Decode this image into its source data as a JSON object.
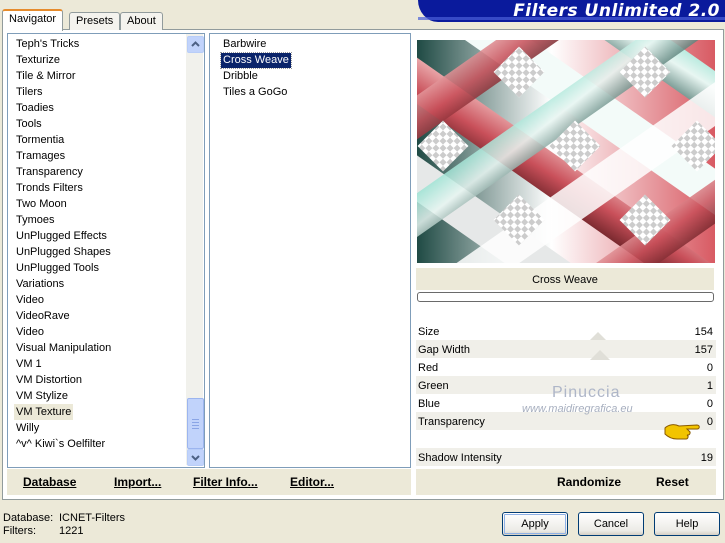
{
  "banner": {
    "title": "Filters Unlimited 2.0"
  },
  "tabs": [
    {
      "label": "Navigator",
      "active": true
    },
    {
      "label": "Presets",
      "active": false
    },
    {
      "label": "About",
      "active": false
    }
  ],
  "categories": [
    "Teph's Tricks",
    "Texturize",
    "Tile & Mirror",
    "Tilers",
    "Toadies",
    "Tools",
    "Tormentia",
    "Tramages",
    "Transparency",
    "Tronds Filters",
    "Two Moon",
    "Tymoes",
    "UnPlugged Effects",
    "UnPlugged Shapes",
    "UnPlugged Tools",
    "Variations",
    "Video",
    "VideoRave",
    "Video",
    "Visual Manipulation",
    "VM 1",
    "VM Distortion",
    "VM Stylize",
    "VM Texture",
    "Willy",
    "^v^ Kiwi`s Oelfilter"
  ],
  "selected_category": "VM Texture",
  "filters": [
    "Barbwire",
    "Cross Weave",
    "Dribble",
    "Tiles a GoGo"
  ],
  "selected_filter": "Cross Weave",
  "preview": {
    "filter_name": "Cross Weave"
  },
  "sliders": [
    {
      "label": "Size",
      "value": "154"
    },
    {
      "label": "Gap Width",
      "value": "157"
    },
    {
      "label": "Red",
      "value": "0"
    },
    {
      "label": "Green",
      "value": "1"
    },
    {
      "label": "Blue",
      "value": "0"
    },
    {
      "label": "Transparency",
      "value": "0"
    },
    {
      "label": "",
      "value": ""
    },
    {
      "label": "Shadow Intensity",
      "value": "19"
    }
  ],
  "watermark": {
    "name": "Pinuccia",
    "site": "www.maidiregrafica.eu"
  },
  "left_buttons": {
    "database": "Database",
    "import": "Import...",
    "filter_info": "Filter Info...",
    "editor": "Editor..."
  },
  "right_buttons": {
    "randomize": "Randomize",
    "reset": "Reset"
  },
  "status": {
    "database_label": "Database:",
    "database_value": "ICNET-Filters",
    "filters_label": "Filters:",
    "filters_value": "1221"
  },
  "dialog_buttons": {
    "apply": "Apply",
    "cancel": "Cancel",
    "help": "Help"
  },
  "colors": {
    "selection": "#0a246a",
    "banner": "#0a1a9c",
    "tab_accent": "#e68b2c"
  }
}
